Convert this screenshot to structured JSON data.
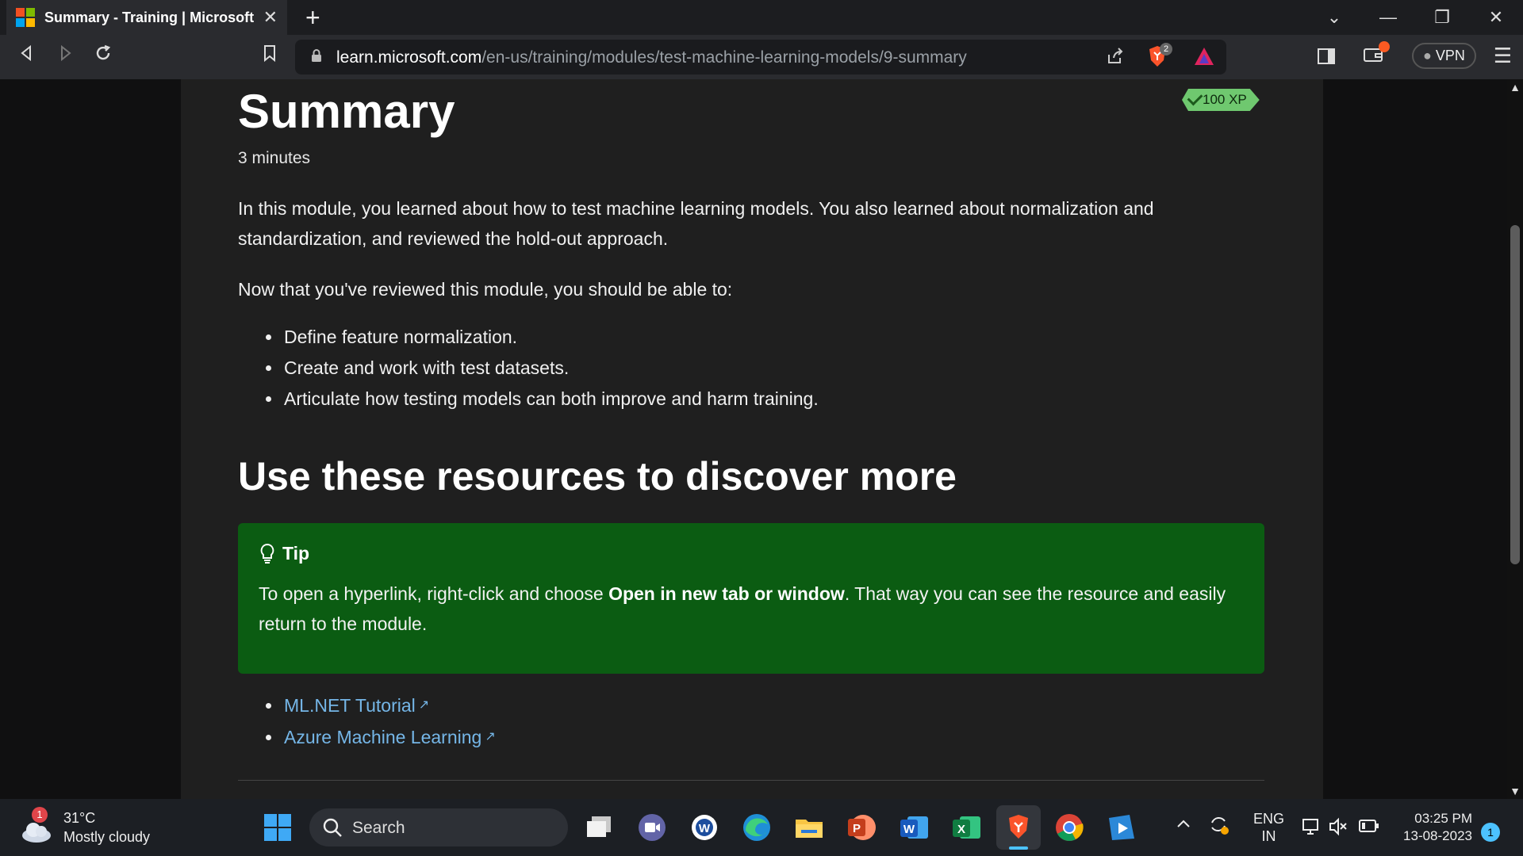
{
  "browser": {
    "tab_title": "Summary - Training | Microsoft Le",
    "url_host": "learn.microsoft.com",
    "url_path": "/en-us/training/modules/test-machine-learning-models/9-summary",
    "shields_count": "2",
    "vpn_label": "VPN"
  },
  "article": {
    "title": "Summary",
    "xp": "100 XP",
    "duration": "3 minutes",
    "intro": "In this module, you learned about how to test machine learning models. You also learned about normalization and standardization, and reviewed the hold-out approach.",
    "objectives_lead": "Now that you've reviewed this module, you should be able to:",
    "objectives": [
      "Define feature normalization.",
      "Create and work with test datasets.",
      "Articulate how testing models can both improve and harm training."
    ],
    "resources_heading": "Use these resources to discover more",
    "tip": {
      "label": "Tip",
      "text_before": "To open a hyperlink, right-click and choose ",
      "text_bold": "Open in new tab or window",
      "text_after": ". That way you can see the resource and easily return to the module."
    },
    "links": [
      "ML.NET Tutorial",
      "Azure Machine Learning"
    ]
  },
  "taskbar": {
    "weather_temp": "31°C",
    "weather_desc": "Mostly cloudy",
    "weather_badge": "1",
    "search_label": "Search",
    "lang_1": "ENG",
    "lang_2": "IN",
    "time": "03:25 PM",
    "date": "13-08-2023",
    "notification_count": "1"
  },
  "colors": {
    "tip_bg": "#0b5c12",
    "link": "#75b6e7",
    "xp_badge": "#6fc86f",
    "brave_orange": "#fb542b"
  }
}
